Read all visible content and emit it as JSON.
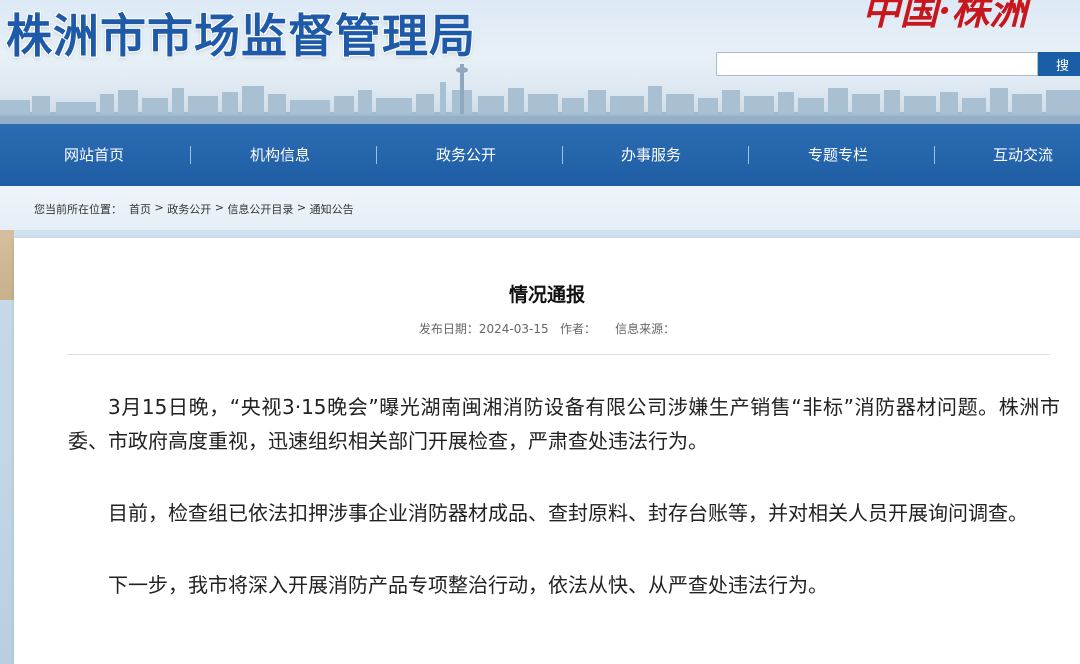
{
  "header": {
    "site_title": "株洲市市场监督管理局",
    "slogan": "中国·株洲",
    "search": {
      "placeholder": "",
      "button_label": "搜"
    }
  },
  "nav": {
    "items": [
      {
        "label": "网站首页"
      },
      {
        "label": "机构信息"
      },
      {
        "label": "政务公开"
      },
      {
        "label": "办事服务"
      },
      {
        "label": "专题专栏"
      },
      {
        "label": "互动交流"
      }
    ]
  },
  "breadcrumb": {
    "prefix": "您当前所在位置：",
    "items": [
      "首页",
      "政务公开",
      "信息公开目录",
      "通知公告"
    ],
    "separator": " > "
  },
  "article": {
    "title": "情况通报",
    "meta": {
      "date_label": "发布日期：",
      "date": "2024-03-15",
      "author_label": "作者：",
      "source_label": "信息来源："
    },
    "paragraphs": [
      "3月15日晚，“央视3·15晚会”曝光湖南闽湘消防设备有限公司涉嫌生产销售“非标”消防器材问题。株洲市委、市政府高度重视，迅速组织相关部门开展检查，严肃查处违法行为。",
      "目前，检查组已依法扣押涉事企业消防器材成品、查封原料、封存台账等，并对相关人员开展询问调查。",
      "下一步，我市将深入开展消防产品专项整治行动，依法从快、从严查处违法行为。"
    ]
  },
  "colors": {
    "brand_blue": "#1f5aa8",
    "nav_blue": "#2266ae",
    "slogan_red": "#c8161d"
  }
}
